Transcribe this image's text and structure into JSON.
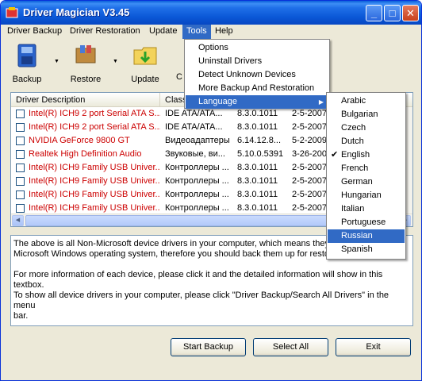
{
  "window": {
    "title": "Driver Magician V3.45"
  },
  "title_buttons": {
    "minimize": "_",
    "maximize": "□",
    "close": "✕"
  },
  "menubar": [
    "Driver Backup",
    "Driver Restoration",
    "Update",
    "Tools",
    "Help"
  ],
  "toolbar": {
    "backup": "Backup",
    "restore": "Restore",
    "update": "Update",
    "partial": "C"
  },
  "list": {
    "columns": [
      "Driver Description",
      "Class",
      "",
      ""
    ],
    "rows": [
      {
        "desc": "Intel(R) ICH9 2 port Serial ATA S...",
        "class": "IDE ATA/ATA...",
        "version": "8.3.0.1011",
        "date": "2-5-2007",
        "red": true
      },
      {
        "desc": "Intel(R) ICH9 2 port Serial ATA S...",
        "class": "IDE ATA/ATA...",
        "version": "8.3.0.1011",
        "date": "2-5-2007",
        "red": true
      },
      {
        "desc": "NVIDIA GeForce 9800 GT",
        "class": "Видеоадаптеры",
        "version": "6.14.12.8...",
        "date": "5-2-2009",
        "red": true
      },
      {
        "desc": "Realtek High Definition Audio",
        "class": "Звуковые, ви...",
        "version": "5.10.0.5391",
        "date": "3-26-200",
        "red": true
      },
      {
        "desc": "Intel(R) ICH9 Family USB Univer...",
        "class": "Контроллеры ...",
        "version": "8.3.0.1011",
        "date": "2-5-2007",
        "red": true
      },
      {
        "desc": "Intel(R) ICH9 Family USB Univer...",
        "class": "Контроллеры ...",
        "version": "8.3.0.1011",
        "date": "2-5-2007",
        "red": true
      },
      {
        "desc": "Intel(R) ICH9 Family USB Univer...",
        "class": "Контроллеры ...",
        "version": "8.3.0.1011",
        "date": "2-5-2007",
        "red": true
      },
      {
        "desc": "Intel(R) ICH9 Family USB Univer...",
        "class": "Контроллеры ...",
        "version": "8.3.0.1011",
        "date": "2-5-2007",
        "red": true
      }
    ]
  },
  "info": {
    "p1": "The above is all Non-Microsoft device drivers in your computer, which means they a...\nMicrosoft Windows operating system, therefore you should back them up for restorat...",
    "p2": "For more information of each device, please click it and the detailed information will show in this textbox.\nTo show all device drivers in your computer, please click \"Driver Backup/Search All Drivers\" in the menu\nbar."
  },
  "buttons": {
    "start_backup": "Start Backup",
    "select_all": "Select All",
    "exit": "Exit"
  },
  "tools_menu": [
    "Options",
    "Uninstall Drivers",
    "Detect Unknown Devices",
    "More Backup And Restoration",
    "Language"
  ],
  "language_menu": [
    "Arabic",
    "Bulgarian",
    "Czech",
    "Dutch",
    "English",
    "French",
    "German",
    "Hungarian",
    "Italian",
    "Portuguese",
    "Russian",
    "Spanish"
  ],
  "selected_language": "English",
  "highlighted_language": "Russian",
  "colors": {
    "highlight": "#316ac5",
    "red_text": "#cc0000",
    "titlebar": "#0a57d6"
  }
}
